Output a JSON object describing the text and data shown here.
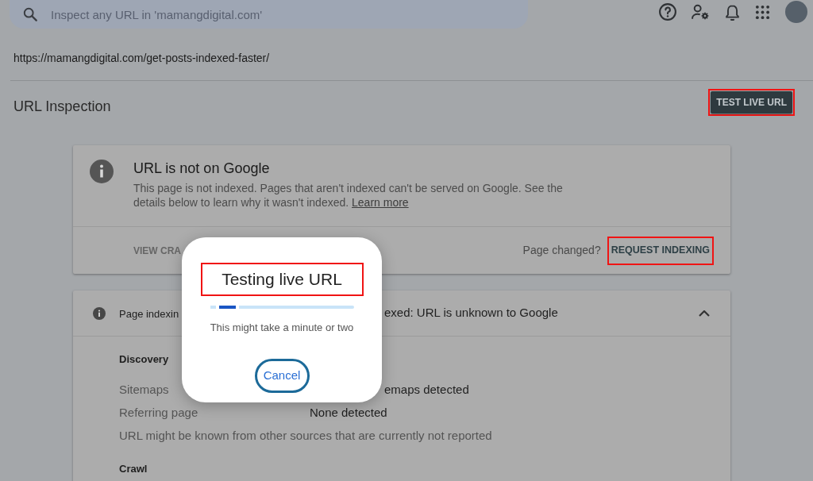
{
  "search": {
    "placeholder": "Inspect any URL in 'mamangdigital.com'"
  },
  "inspected_url": "https://mamangdigital.com/get-posts-indexed-faster/",
  "page_header": {
    "title": "URL Inspection",
    "action": {
      "label": "TEST LIVE URL",
      "highlighted": true
    }
  },
  "status_card": {
    "title": "URL is not on Google",
    "description": "This page is not indexed. Pages that aren't indexed can't be served on Google. See the details below to learn why it wasn't indexed.",
    "link": "Learn more",
    "footer_button": "VIEW CRA",
    "prompt": "Page changed?",
    "action": {
      "label": "REQUEST INDEXING",
      "highlighted": true
    }
  },
  "indexing_card": {
    "label": "Page indexin",
    "status": "exed: URL is unknown to Google",
    "expanded": true,
    "sections": [
      {
        "heading": "Discovery",
        "rows": [
          {
            "kind": "pair",
            "label": "Sitemaps",
            "value": "emaps detected",
            "covered": true
          },
          {
            "kind": "pair",
            "label": "Referring page",
            "value": "None detected",
            "covered": false
          },
          {
            "kind": "note",
            "text": "URL might be known from other sources that are currently not reported"
          }
        ]
      },
      {
        "heading": "Crawl"
      }
    ]
  },
  "dialog": {
    "title": "Testing live URL",
    "highlighted": true,
    "level": 0.2,
    "message": "This might take a minute or two",
    "button": "Cancel"
  }
}
